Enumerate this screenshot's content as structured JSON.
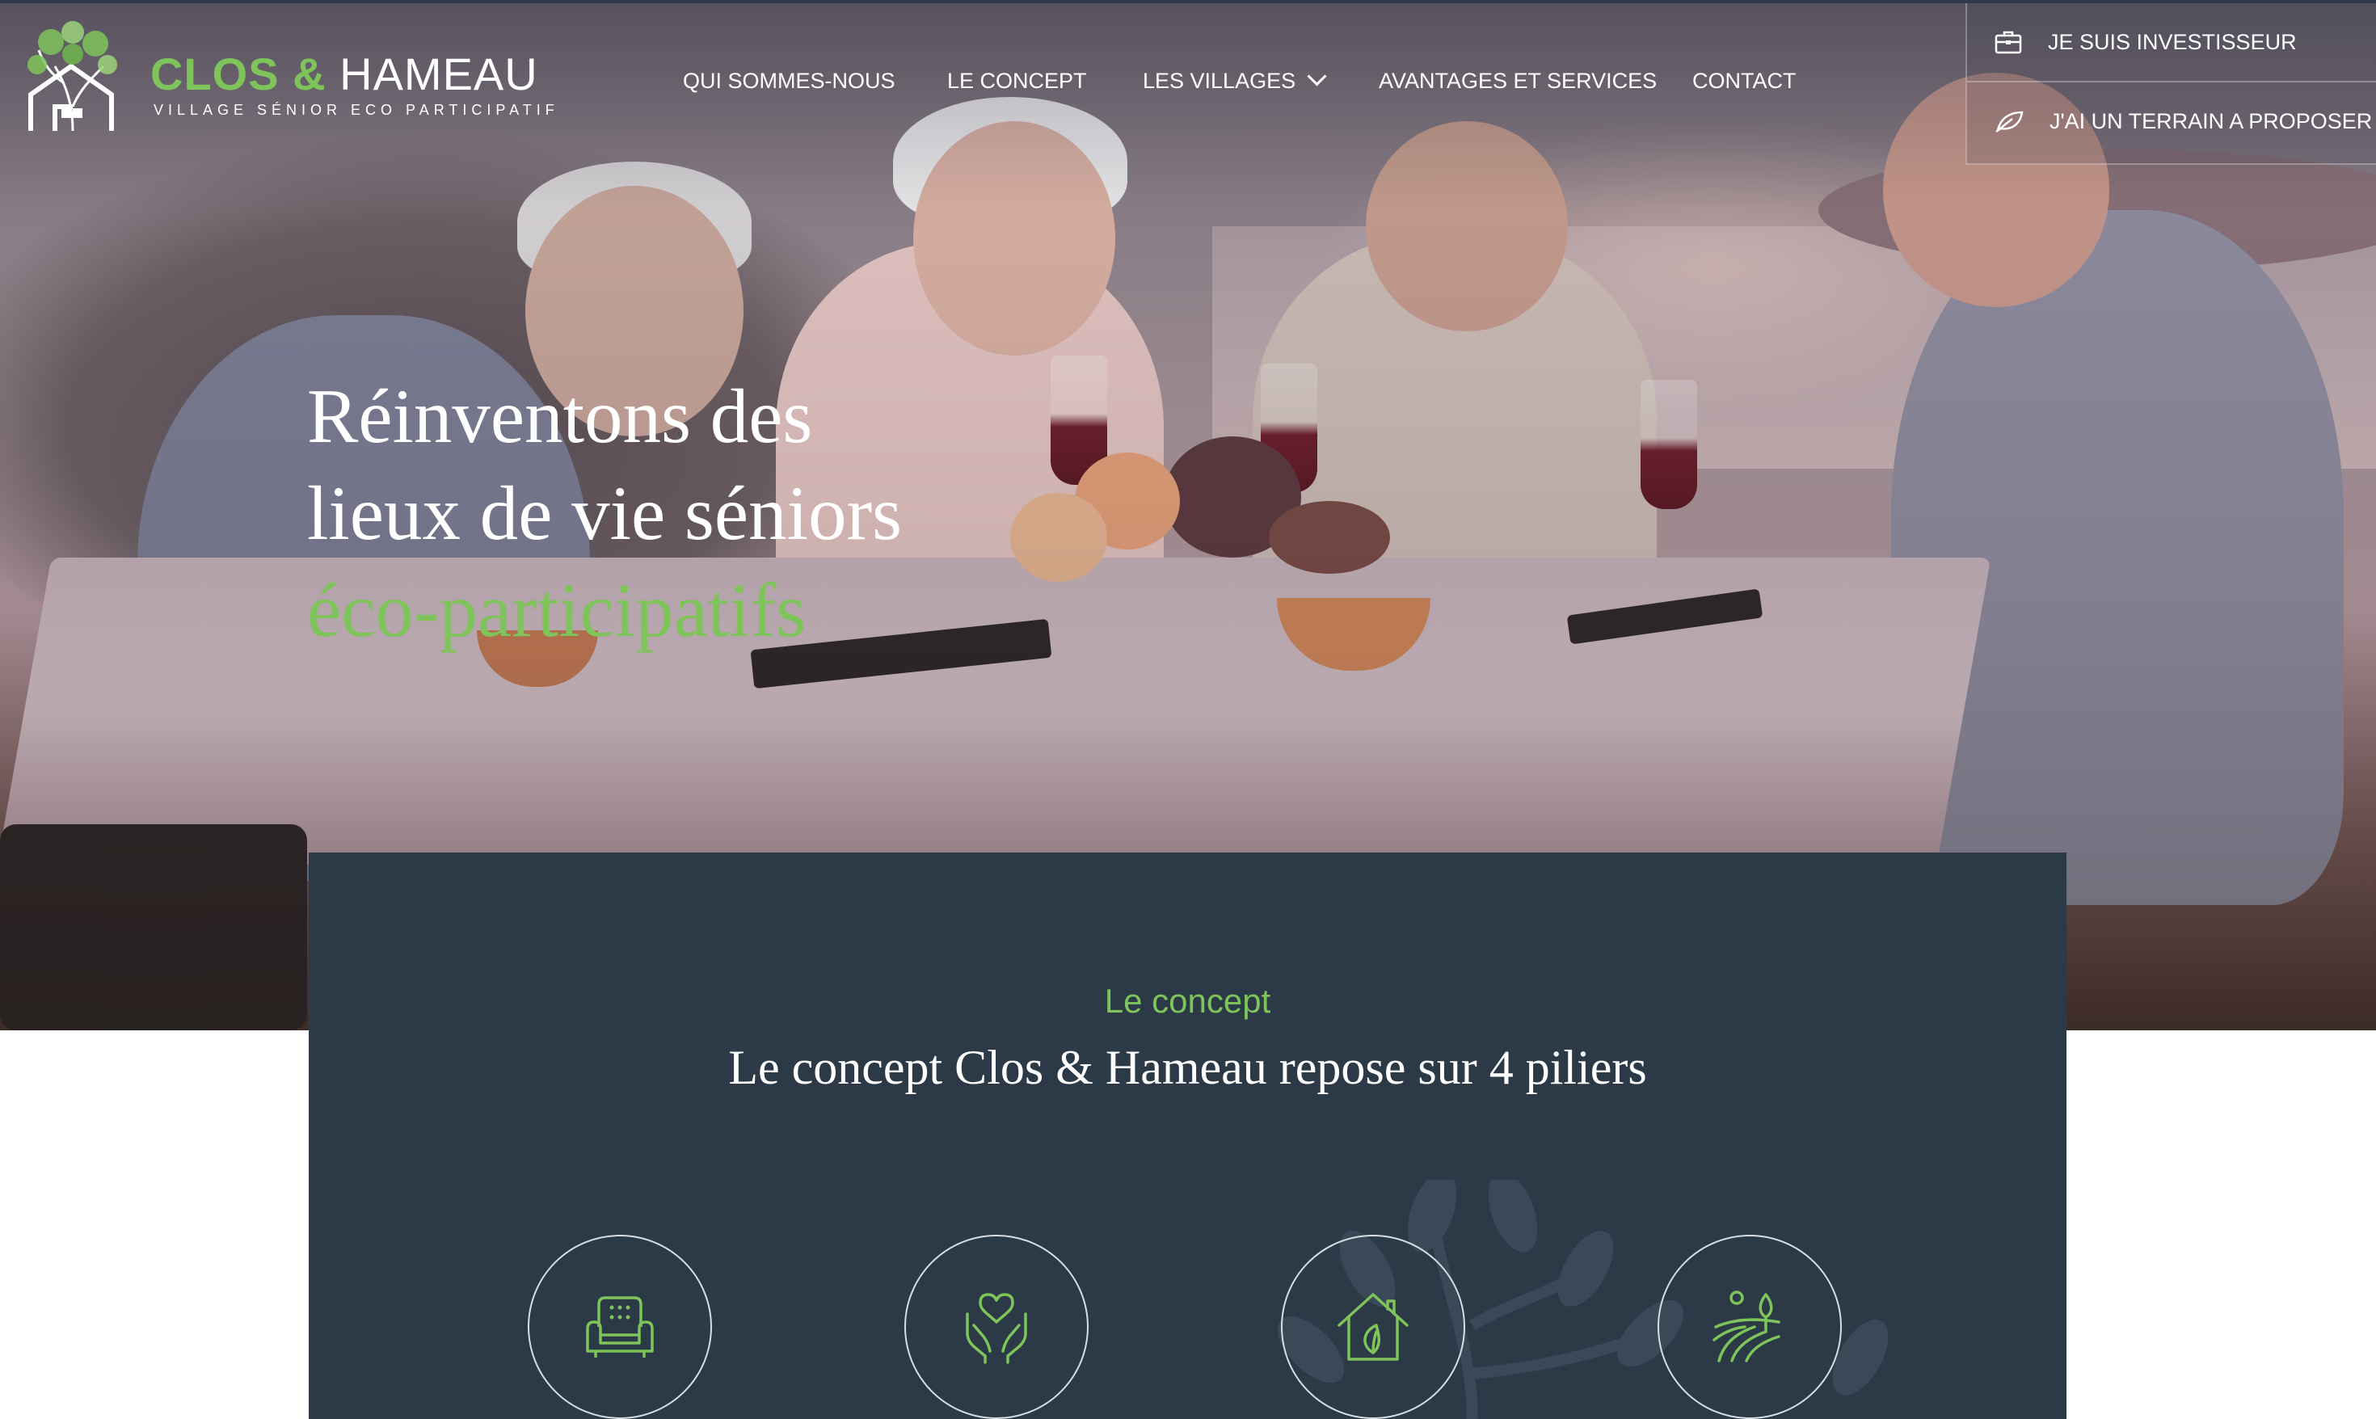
{
  "brand": {
    "name_part1": "CLOS",
    "name_amp": "&",
    "name_part2": "HAMEAU",
    "tagline": "VILLAGE SÉNIOR ECO PARTICIPATIF"
  },
  "nav": {
    "items": [
      {
        "label": "QUI SOMMES-NOUS"
      },
      {
        "label": "LE CONCEPT"
      },
      {
        "label": "LES VILLAGES"
      },
      {
        "label": "AVANTAGES ET SERVICES"
      },
      {
        "label": "CONTACT"
      }
    ]
  },
  "cta": {
    "investor": "JE SUIS INVESTISSEUR",
    "land": "J'AI UN TERRAIN A PROPOSER"
  },
  "hero": {
    "line1": "Réinventons des",
    "line2": "lieux de vie séniors",
    "line3": "éco-participatifs"
  },
  "concept": {
    "kicker": "Le concept",
    "title": "Le concept Clos & Hameau repose sur 4 piliers",
    "pillars": [
      {
        "icon": "armchair-icon"
      },
      {
        "icon": "heart-hands-icon"
      },
      {
        "icon": "eco-house-icon"
      },
      {
        "icon": "field-icon"
      }
    ]
  },
  "colors": {
    "accent": "#7ec45a",
    "panel": "#2c3947",
    "text_light": "#ffffff"
  }
}
